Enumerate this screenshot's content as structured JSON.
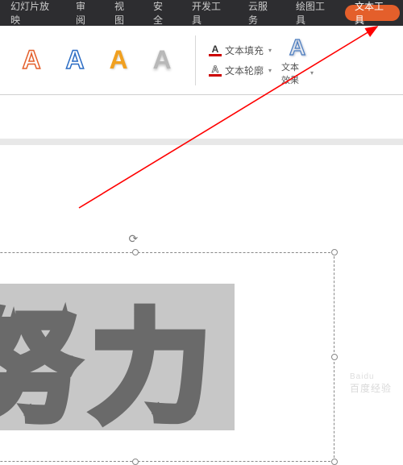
{
  "tabs": {
    "slideshow": "幻灯片放映",
    "review": "审阅",
    "view": "视图",
    "security": "安全",
    "devtools": "开发工具",
    "cloud": "云服务",
    "drawtools": "绘图工具",
    "texttools": "文本工具"
  },
  "ribbon": {
    "wordart_glyph": "A",
    "text_fill": "文本填充",
    "text_outline": "文本轮廓",
    "text_effects": "文本效果"
  },
  "canvas": {
    "char1": "努",
    "char2": "力"
  },
  "watermark": {
    "line1": "Baidu",
    "line2": "百度经验"
  }
}
